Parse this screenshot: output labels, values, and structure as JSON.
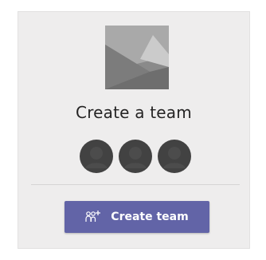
{
  "card": {
    "title": "Create a team",
    "thumbnail_icon": "team-placeholder-image",
    "avatar_icon": "person-avatar-icon",
    "avatar_count": 3
  },
  "create_button": {
    "label": "Create team",
    "icon": "people-add-icon"
  },
  "colors": {
    "accent": "#6264a7",
    "card_background": "#eeeded",
    "title_text": "#252424",
    "avatar": "#424242"
  }
}
